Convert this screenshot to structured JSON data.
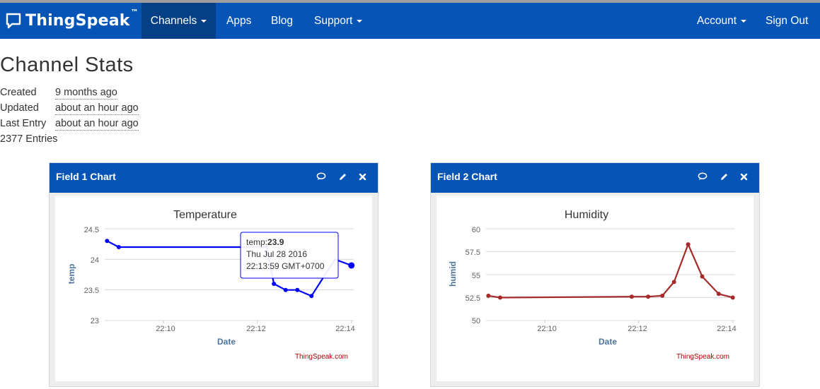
{
  "nav": {
    "brand": "ThingSpeak",
    "brand_tm": "™",
    "items": [
      {
        "label": "Channels",
        "dropdown": true,
        "active": true
      },
      {
        "label": "Apps"
      },
      {
        "label": "Blog"
      },
      {
        "label": "Support",
        "dropdown": true
      },
      {
        "label": "Account",
        "dropdown": true
      },
      {
        "label": "Sign Out"
      }
    ],
    "colors": {
      "navbar": "#0654b5",
      "active": "#053f86"
    }
  },
  "page": {
    "title": "Channel Stats",
    "stats": [
      {
        "label": "Created",
        "value": "9 months ago"
      },
      {
        "label": "Updated",
        "value": "about an hour ago"
      },
      {
        "label": "Last Entry",
        "value": "about an hour ago"
      }
    ],
    "entries": "2377 Entries"
  },
  "panels": [
    {
      "title": "Field 1 Chart",
      "icons": [
        "comment-icon",
        "pencil-icon",
        "close-icon"
      ]
    },
    {
      "title": "Field 2 Chart",
      "icons": [
        "comment-icon",
        "pencil-icon",
        "close-icon"
      ]
    }
  ],
  "chart_data": [
    {
      "type": "line",
      "title": "Temperature",
      "xlabel": "Date",
      "ylabel": "temp",
      "credit": "ThingSpeak.com",
      "color": "#0000ff",
      "x_ticks": [
        "22:10",
        "22:12",
        "22:14"
      ],
      "x_tick_minutes": [
        10,
        12,
        14
      ],
      "x_range_minutes": [
        8.75,
        14.05
      ],
      "y_ticks": [
        "24.5",
        "24",
        "23.5",
        "23"
      ],
      "ylim": [
        23,
        24.5
      ],
      "series": [
        {
          "x_minutes": [
            8.8,
            9.05,
            12.2,
            12.35,
            12.6,
            12.85,
            13.15,
            13.65,
            14.0
          ],
          "values": [
            24.3,
            24.2,
            24.2,
            23.6,
            23.5,
            23.5,
            23.4,
            24.0,
            23.9
          ],
          "markers": [
            true,
            true,
            false,
            true,
            true,
            true,
            true,
            false,
            true
          ]
        }
      ],
      "grid": true,
      "tooltip": {
        "label": "temp:",
        "value": "23.9",
        "line2": "Thu Jul 28 2016",
        "line3": "22:13:59 GMT+0700"
      }
    },
    {
      "type": "line",
      "title": "Humidity",
      "xlabel": "Date",
      "ylabel": "humid",
      "credit": "ThingSpeak.com",
      "color": "#a52a2a",
      "x_ticks": [
        "22:10",
        "22:12",
        "22:14"
      ],
      "x_tick_minutes": [
        10,
        12,
        14
      ],
      "x_range_minutes": [
        8.75,
        14.05
      ],
      "y_ticks": [
        "60",
        "57.5",
        "55",
        "52.5",
        "50"
      ],
      "ylim": [
        50,
        60
      ],
      "series": [
        {
          "x_minutes": [
            8.8,
            9.05,
            11.85,
            12.2,
            12.5,
            12.75,
            13.05,
            13.35,
            13.7,
            14.0
          ],
          "values": [
            52.7,
            52.5,
            52.6,
            52.6,
            52.7,
            54.2,
            58.3,
            54.8,
            52.9,
            52.5
          ],
          "markers": [
            true,
            true,
            true,
            true,
            true,
            true,
            true,
            true,
            true,
            true
          ]
        }
      ],
      "grid": true
    }
  ]
}
